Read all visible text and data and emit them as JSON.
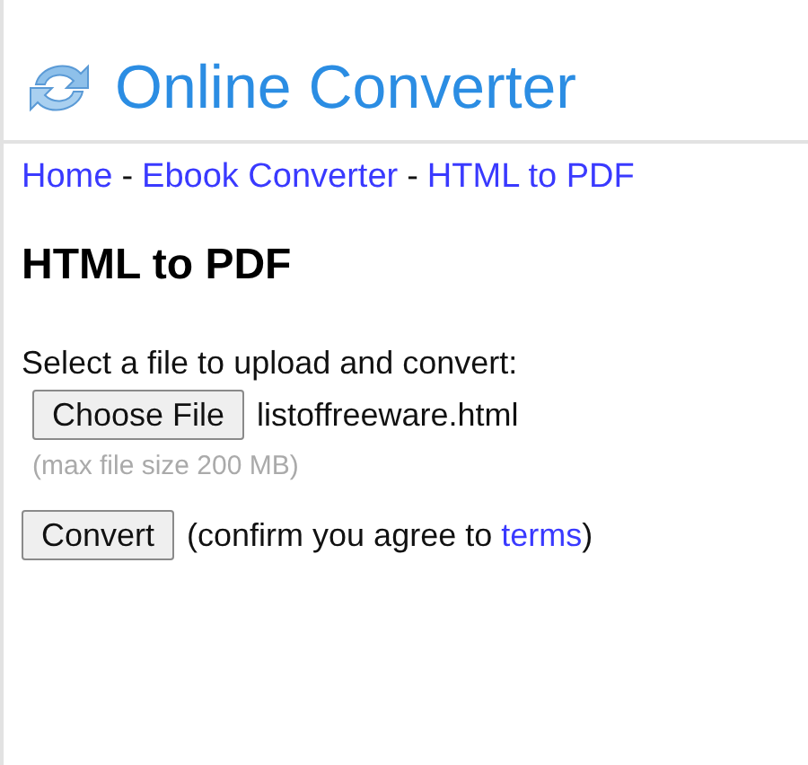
{
  "header": {
    "title": "Online Converter"
  },
  "breadcrumb": {
    "separator": "-",
    "items": [
      {
        "label": "Home"
      },
      {
        "label": "Ebook Converter"
      },
      {
        "label": "HTML to PDF"
      }
    ]
  },
  "heading": "HTML to PDF",
  "upload": {
    "label": "Select a file to upload and convert:",
    "button": "Choose File",
    "file_name": "listoffreeware.html",
    "hint": "(max file size 200 MB)"
  },
  "convert": {
    "button": "Convert",
    "note_before": "(confirm you agree to ",
    "note_link": "terms",
    "note_after": ")"
  }
}
